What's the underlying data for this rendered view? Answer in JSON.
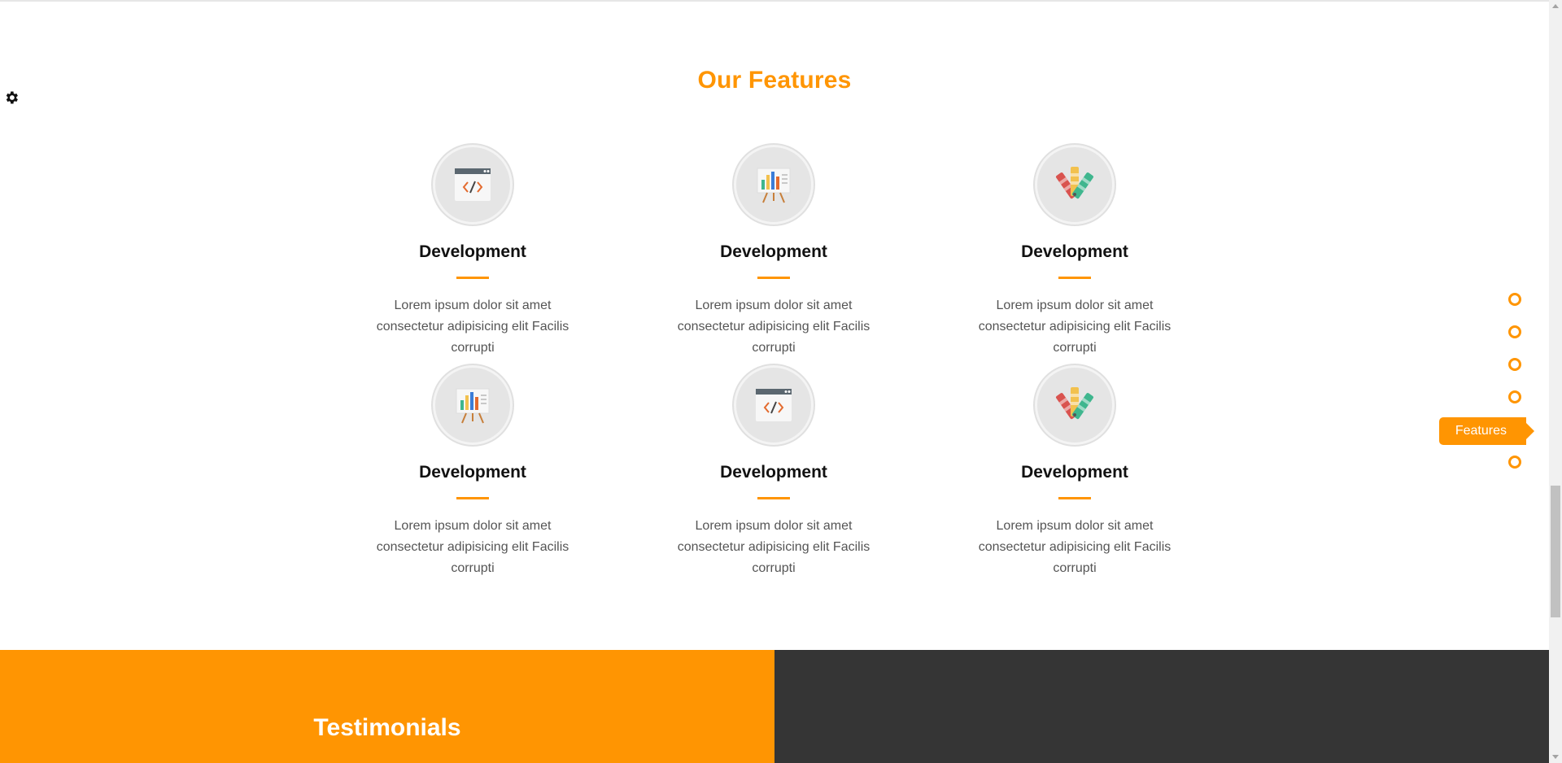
{
  "features": {
    "title": "Our Features",
    "items": [
      {
        "icon": "code-window-icon",
        "title": "Development",
        "text": "Lorem ipsum dolor sit amet consectetur adipisicing elit Facilis corrupti"
      },
      {
        "icon": "presentation-chart-icon",
        "title": "Development",
        "text": "Lorem ipsum dolor sit amet consectetur adipisicing elit Facilis corrupti"
      },
      {
        "icon": "color-palette-icon",
        "title": "Development",
        "text": "Lorem ipsum dolor sit amet consectetur adipisicing elit Facilis corrupti"
      },
      {
        "icon": "presentation-chart-icon",
        "title": "Development",
        "text": "Lorem ipsum dolor sit amet consectetur adipisicing elit Facilis corrupti"
      },
      {
        "icon": "code-window-icon",
        "title": "Development",
        "text": "Lorem ipsum dolor sit amet consectetur adipisicing elit Facilis corrupti"
      },
      {
        "icon": "color-palette-icon",
        "title": "Development",
        "text": "Lorem ipsum dolor sit amet consectetur adipisicing elit Facilis corrupti"
      }
    ]
  },
  "testimonials": {
    "title": "Testimonials"
  },
  "section_nav": {
    "active_label": "Features",
    "active_index": 4,
    "count": 6
  },
  "settings": {
    "icon": "gear-icon"
  },
  "colors": {
    "accent": "#ff9502",
    "dark": "#353535",
    "text": "#555555"
  }
}
